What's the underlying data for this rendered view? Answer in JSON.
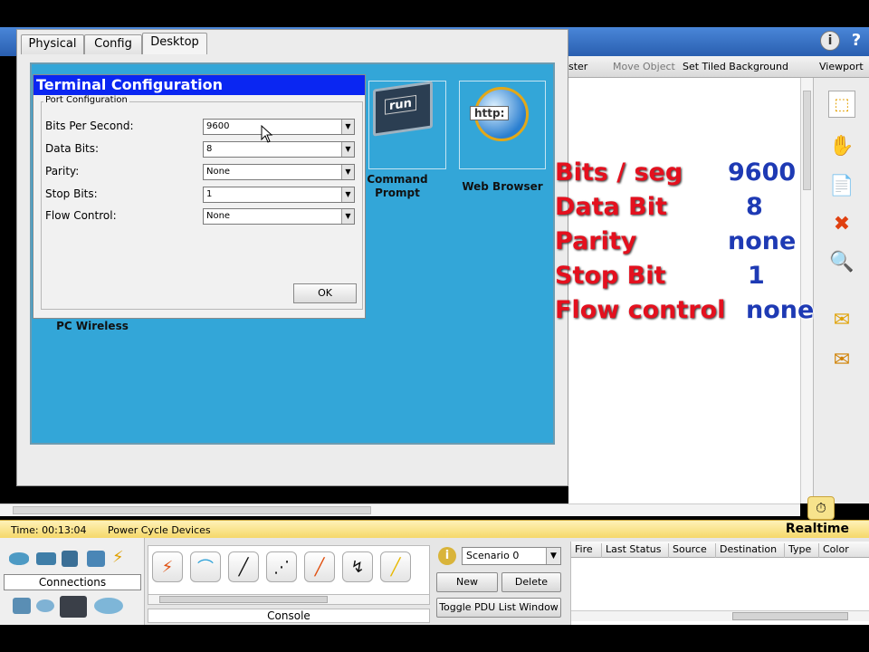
{
  "pc_window": {
    "tabs": [
      {
        "label": "Physical"
      },
      {
        "label": "Config"
      },
      {
        "label": "Desktop"
      }
    ],
    "desktop_apps": [
      {
        "label": "PC Wireless"
      },
      {
        "label": "Command Prompt",
        "icon_text": "run"
      },
      {
        "label": "Web Browser",
        "icon_text": "http:"
      }
    ]
  },
  "terminal": {
    "title": "Terminal Configuration",
    "group_label": "Port Configuration",
    "fields": [
      {
        "label": "Bits Per Second:",
        "value": "9600"
      },
      {
        "label": "Data Bits:",
        "value": "8"
      },
      {
        "label": "Parity:",
        "value": "None"
      },
      {
        "label": "Stop Bits:",
        "value": "1"
      },
      {
        "label": "Flow Control:",
        "value": "None"
      }
    ],
    "ok_label": "OK"
  },
  "main_menu": {
    "items": [
      "ster",
      "Move Object",
      "Set Tiled Background",
      "Viewport"
    ]
  },
  "overlay": {
    "rows": [
      {
        "label": "Bits / seg",
        "value": "9600"
      },
      {
        "label": "Data Bit",
        "value": "8"
      },
      {
        "label": "Parity",
        "value": "none"
      },
      {
        "label": "Stop Bit",
        "value": "1"
      },
      {
        "label": "Flow control",
        "value": "none"
      }
    ]
  },
  "status": {
    "time": "Time: 00:13:04",
    "power_cycle": "Power Cycle Devices",
    "mode": "Realtime"
  },
  "bottom": {
    "connections_label": "Connections",
    "console_label": "Console",
    "scenario": "Scenario 0",
    "new_label": "New",
    "delete_label": "Delete",
    "toggle_label": "Toggle PDU List Window",
    "pdu_columns": [
      "Fire",
      "Last Status",
      "Source",
      "Destination",
      "Type",
      "Color"
    ]
  },
  "colors": {
    "terminal_title_bg": "#0a26f2",
    "desktop_bg": "#33a6d8",
    "overlay_label": "#e4101e",
    "overlay_value": "#1e3ab4",
    "status_bar": "#f5d86a"
  }
}
